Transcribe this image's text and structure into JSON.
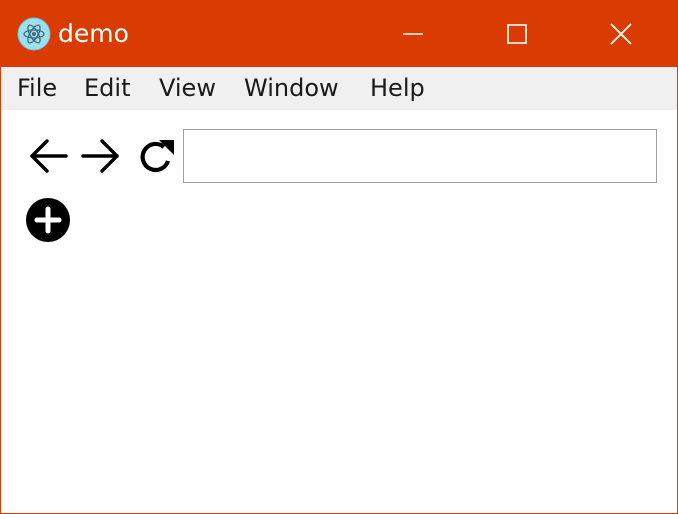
{
  "window": {
    "title": "demo",
    "accent_color": "#da3b01",
    "app_icon": "electron-atom-icon"
  },
  "caption_buttons": {
    "minimize_icon": "minimize-icon",
    "maximize_icon": "maximize-icon",
    "close_icon": "close-icon"
  },
  "menu": {
    "items": [
      "File",
      "Edit",
      "View",
      "Window",
      "Help"
    ]
  },
  "toolbar": {
    "back_icon": "arrow-left-icon",
    "forward_icon": "arrow-right-icon",
    "reload_icon": "reload-icon",
    "add_icon": "plus-circle-icon",
    "url_value": "",
    "url_placeholder": ""
  }
}
